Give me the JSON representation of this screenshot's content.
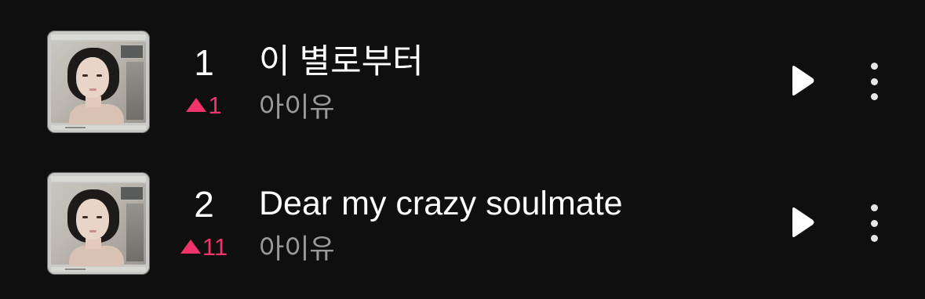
{
  "tracks": [
    {
      "rank": "1",
      "change": "1",
      "title": "이 별로부터",
      "artist": "아이유"
    },
    {
      "rank": "2",
      "change": "11",
      "title": "Dear my crazy soulmate",
      "artist": "아이유"
    }
  ],
  "icons": {
    "play": "play-icon",
    "more": "more-vertical-icon",
    "rank_up": "triangle-up-icon"
  },
  "colors": {
    "background": "#0f0f0f",
    "title": "#ffffff",
    "artist": "#9a9a9a",
    "rank_up": "#f0336a"
  }
}
